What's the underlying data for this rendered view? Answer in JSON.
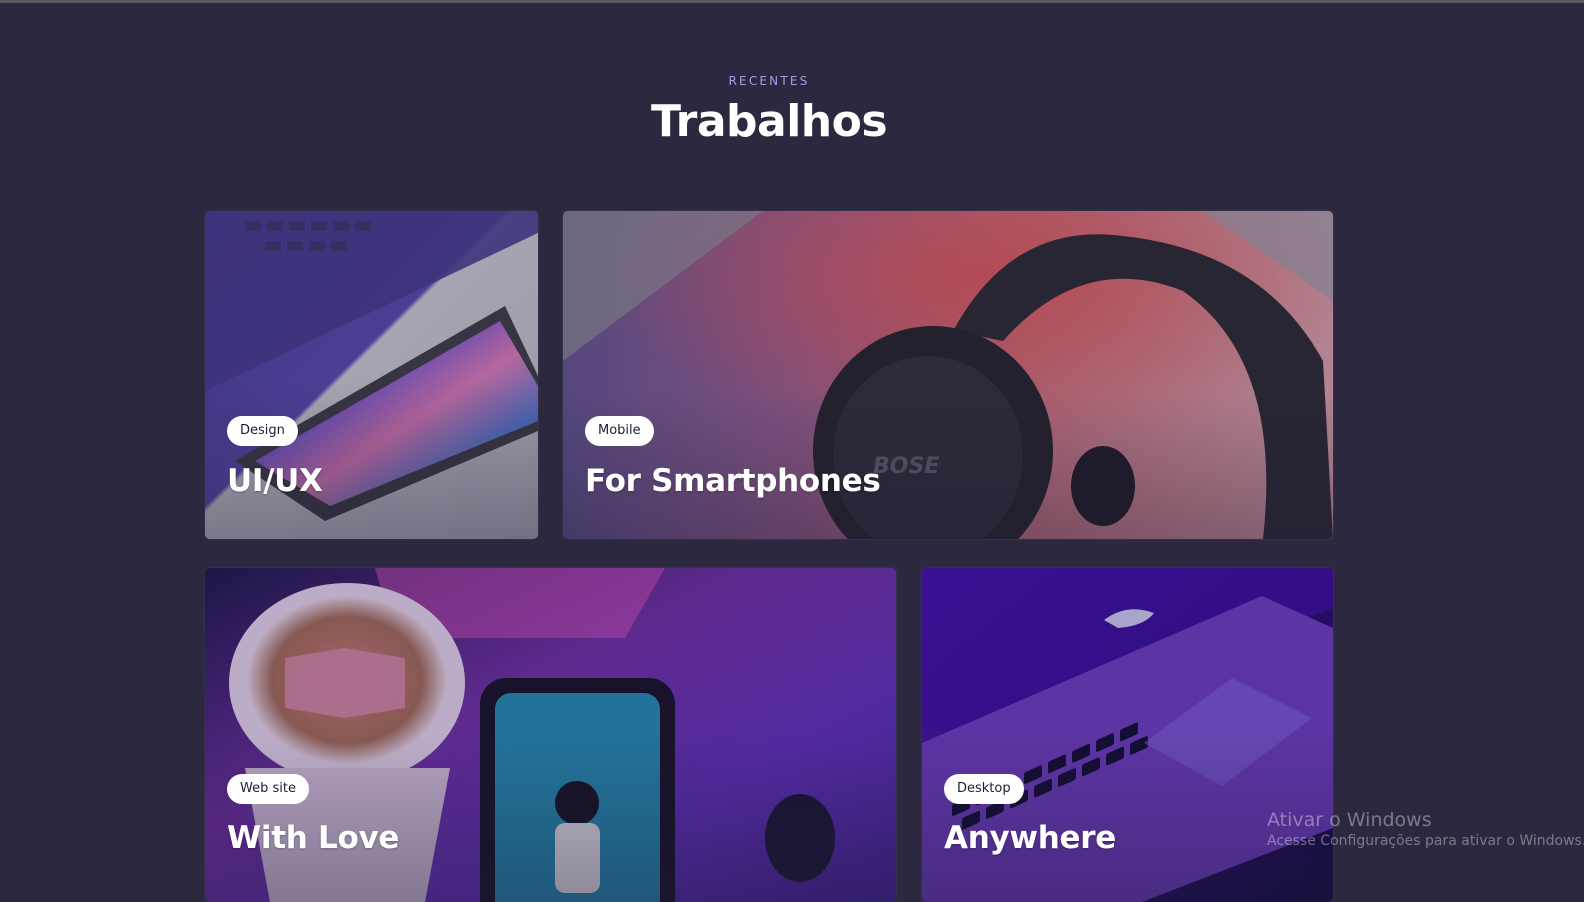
{
  "section": {
    "kicker": "RECENTES",
    "title": "Trabalhos"
  },
  "cards": [
    {
      "tag": "Design",
      "title": "UI/UX",
      "image": "phone-on-laptop-photo"
    },
    {
      "tag": "Mobile",
      "title": "For Smartphones",
      "image": "headphones-on-laptop-photo"
    },
    {
      "tag": "Web site",
      "title": "With Love",
      "image": "coffee-and-phone-photo"
    },
    {
      "tag": "Desktop",
      "title": "Anywhere",
      "image": "laptop-keyboard-photo"
    }
  ],
  "os_watermark": {
    "title": "Ativar o Windows",
    "subtitle": "Acesse Configurações para ativar o Windows."
  },
  "colors": {
    "background": "#2b2840",
    "kicker": "#a99ae6",
    "tag_background": "#ffffff",
    "tag_text": "#1f1d33"
  }
}
